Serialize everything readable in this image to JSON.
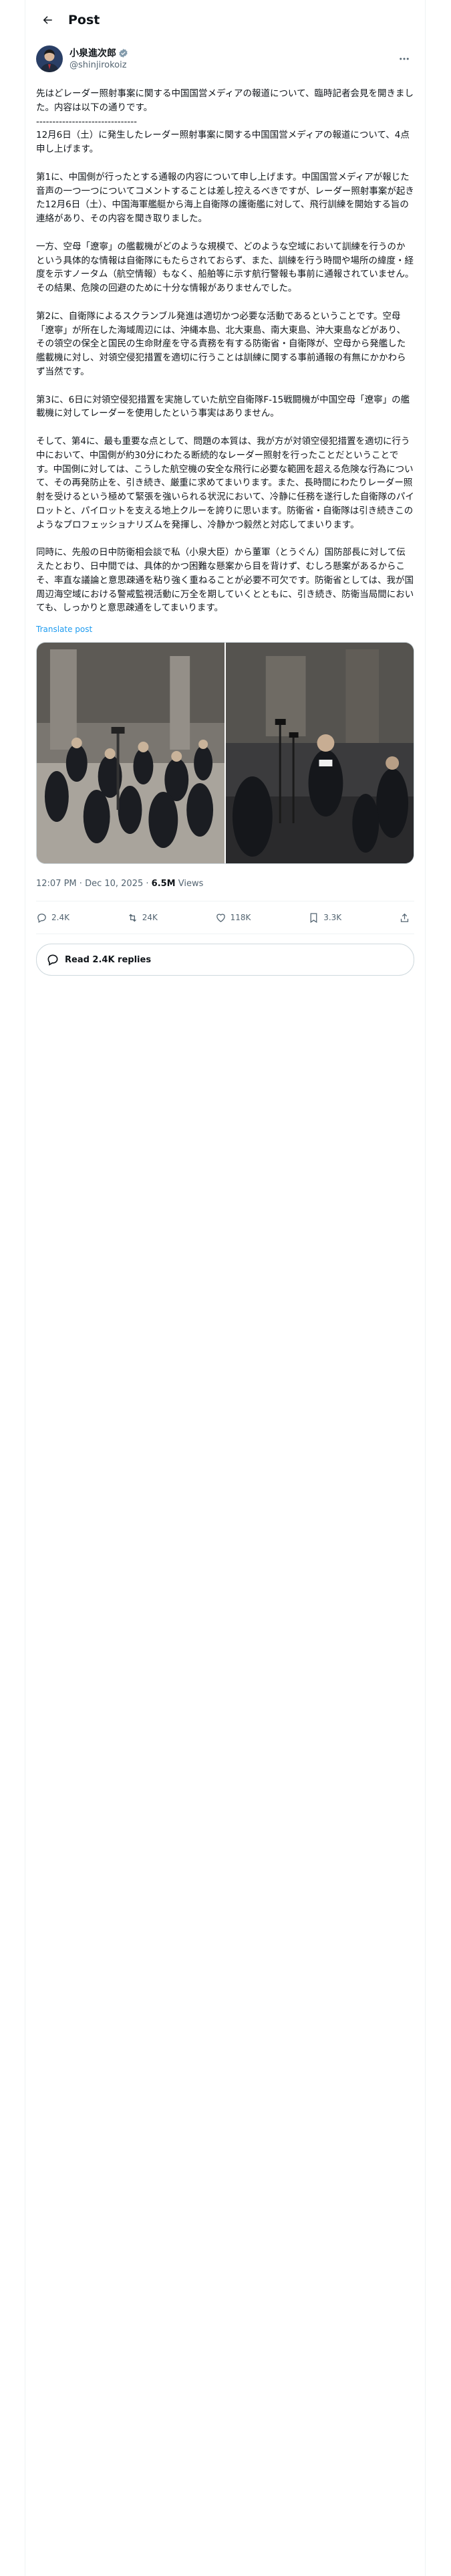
{
  "header": {
    "title": "Post"
  },
  "author": {
    "name": "小泉進次郎",
    "handle": "@shinjirokoiz"
  },
  "post": {
    "text": "先はどレーダー照射事案に関する中国国営メディアの報道について、臨時記者会見を開きました。内容は以下の通りです。\n-------------------------------\n12月6日（土）に発生したレーダー照射事案に関する中国国営メディアの報道について、4点申し上げます。\n\n第1に、中国側が行ったとする通報の内容について申し上げます。中国国営メディアが報じた音声の一つ一つについてコメントすることは差し控えるべきですが、レーダー照射事案が起きた12月6日（土）、中国海軍艦艇から海上自衛隊の護衛艦に対して、飛行訓練を開始する旨の連絡があり、その内容を聞き取りました。\n\n一方、空母「遼寧」の艦載機がどのような規模で、どのような空域において訓練を行うのかという具体的な情報は自衛隊にもたらされておらず、また、訓練を行う時間や場所の緯度・経度を示すノータム（航空情報）もなく、船舶等に示す航行警報も事前に通報されていません。その結果、危険の回避のために十分な情報がありませんでした。\n\n第2に、自衛隊によるスクランブル発進は適切かつ必要な活動であるということです。空母「遼寧」が所在した海域周辺には、沖縄本島、北大東島、南大東島、沖大東島などがあり、その領空の保全と国民の生命財産を守る責務を有する防衛省・自衛隊が、空母から発艦した艦載機に対し、対領空侵犯措置を適切に行うことは訓練に関する事前通報の有無にかかわらず当然です。\n\n第3に、6日に対領空侵犯措置を実施していた航空自衛隊F-15戦闘機が中国空母「遼寧」の艦載機に対してレーダーを使用したという事実はありません。\n\nそして、第4に、最も重要な点として、問題の本質は、我が方が対領空侵犯措置を適切に行う中において、中国側が約30分にわたる断続的なレーダー照射を行ったことだということです。中国側に対しては、こうした航空機の安全な飛行に必要な範囲を超える危険な行為について、その再発防止を、引き続き、厳重に求めてまいります。また、長時間にわたりレーダー照射を受けるという極めて緊張を強いられる状況において、冷静に任務を遂行した自衛隊のパイロットと、パイロットを支える地上クルーを誇りに思います。防衛省・自衛隊は引き続きこのようなプロフェッショナリズムを発揮し、冷静かつ毅然と対応してまいります。\n\n同時に、先般の日中防衛相会談で私（小泉大臣）から董軍（とうぐん）国防部長に対して伝えたとおり、日中間では、具体的かつ困難な懸案から目を背けず、むしろ懸案があるからこそ、率直な議論と意思疎通を粘り強く重ねることが必要不可欠です。防衛省としては、我が国周辺海空域における警戒監視活動に万全を期していくとともに、引き続き、防衛当局間においても、しっかりと意思疎通をしてまいります。",
    "translate_label": "Translate post",
    "time": "12:07 PM",
    "date": "Dec 10, 2025",
    "separator": " · ",
    "views": "6.5M",
    "views_label": " Views"
  },
  "actions": {
    "replies": "2.4K",
    "reposts": "24K",
    "likes": "118K",
    "bookmarks": "3.3K"
  },
  "read_replies_label": "Read 2.4K replies",
  "colors": {
    "link": "#1d9bf0",
    "verified": "#829aab",
    "muted": "#536471",
    "border": "#eff3f4"
  }
}
